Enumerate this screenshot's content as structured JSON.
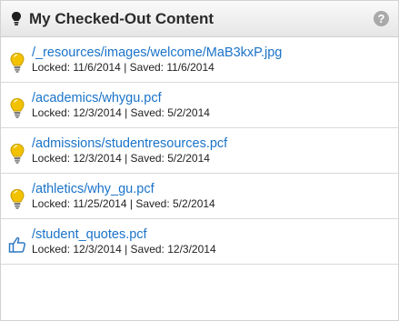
{
  "panel": {
    "title": "My Checked-Out Content",
    "help_label": "?"
  },
  "items": [
    {
      "path": "/_resources/images/welcome/MaB3kxP.jpg",
      "meta": "Locked: 11/6/2014 | Saved: 11/6/2014",
      "icon": "lightbulb-icon"
    },
    {
      "path": "/academics/whygu.pcf",
      "meta": "Locked: 12/3/2014 | Saved: 5/2/2014",
      "icon": "lightbulb-icon"
    },
    {
      "path": "/admissions/studentresources.pcf",
      "meta": "Locked: 12/3/2014 | Saved: 5/2/2014",
      "icon": "lightbulb-icon"
    },
    {
      "path": "/athletics/why_gu.pcf",
      "meta": "Locked: 11/25/2014 | Saved: 5/2/2014",
      "icon": "lightbulb-icon"
    },
    {
      "path": "/student_quotes.pcf",
      "meta": "Locked: 12/3/2014 | Saved: 12/3/2014",
      "icon": "thumbs-up-icon"
    }
  ],
  "colors": {
    "link": "#1a73c9",
    "bulb": "#f2c200",
    "thumb": "#2f78c4"
  }
}
